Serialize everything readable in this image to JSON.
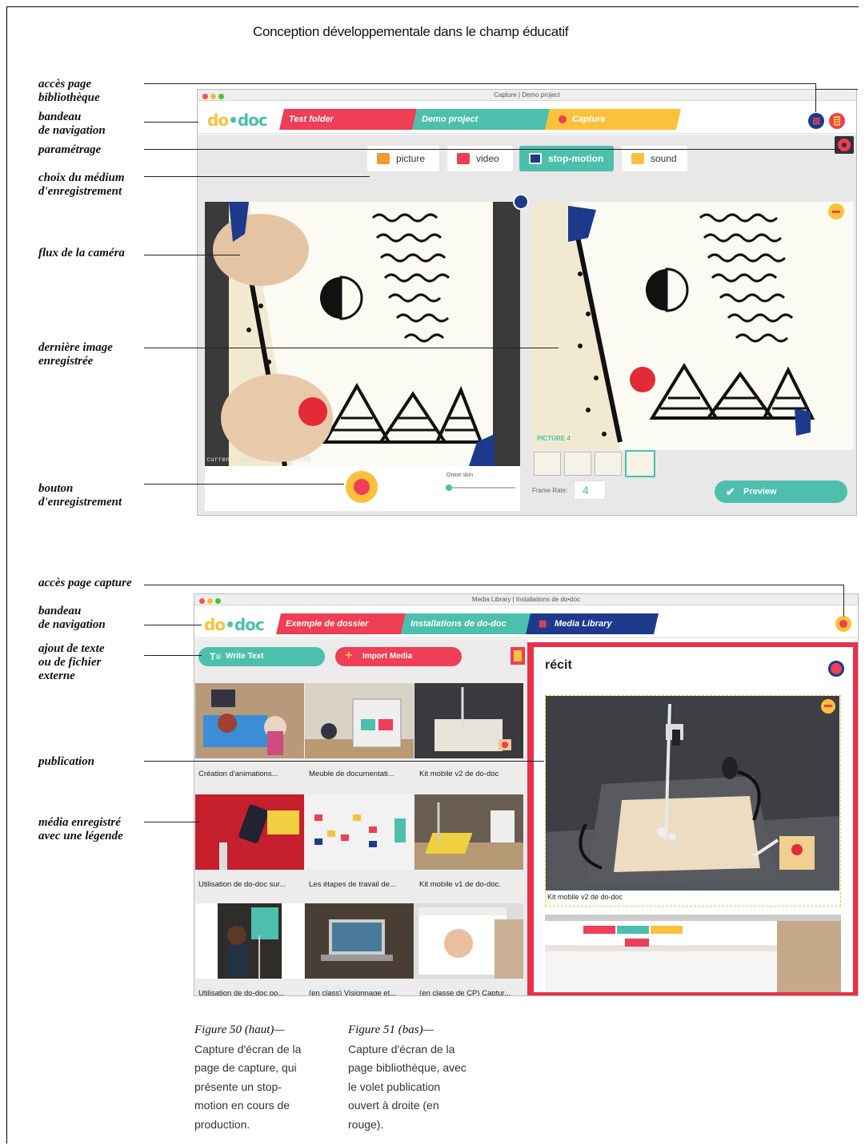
{
  "page_title": "Conception développementale dans le champ éducatif",
  "annotations_top": [
    [
      "accès page",
      "bibliothèque"
    ],
    [
      "bandeau",
      "de navigation"
    ],
    [
      "paramétrage"
    ],
    [
      "choix du médium",
      "d'enregistrement"
    ],
    [
      "flux de la caméra"
    ],
    [
      "dernière image",
      "enregistrée"
    ],
    [
      "bouton",
      "d'enregistrement"
    ]
  ],
  "annotations_bottom": [
    [
      "accès page capture"
    ],
    [
      "bandeau",
      "de navigation"
    ],
    [
      "ajout de texte",
      "ou de fichier",
      "externe"
    ],
    [
      "publication"
    ],
    [
      "média enregistré",
      "avec une légende"
    ]
  ],
  "capture_window": {
    "title": "Capture | Demo project",
    "logo": "do•doc",
    "tabs": [
      "Test folder",
      "Demo project",
      "Capture"
    ],
    "media_buttons": [
      "picture",
      "video",
      "stop-motion",
      "sound"
    ],
    "resolution": "current resolution: 720×720",
    "onion_skin": "Onion skin",
    "picture_label": "PICTURE 4",
    "frame_rate_label": "Frame Rate:",
    "frame_rate_value": "4",
    "preview_label": "Preview",
    "onion_level": 0.05
  },
  "library_window": {
    "title": "Media Library | Installations de do•doc",
    "logo": "do•doc",
    "tabs": [
      "Exemple de dossier",
      "Installations de do-doc",
      "Media Library"
    ],
    "write_text": "Write Text",
    "import_media": "Import Media",
    "captions": [
      "Création d'animations...",
      "Meuble de documentati...",
      "Kit mobile v2 de do-doc",
      "Utilisation de do-doc sur...",
      "Les étapes de travail de...",
      "Kit mobile v1 de do-doc.",
      "Utilisation de do-doc po...",
      "(en class) Visionnage et...",
      "(en classe de CP) Captur..."
    ],
    "panel_title": "récit",
    "panel_caption": "Kit mobile v2 de do-doc"
  },
  "figures": [
    {
      "heading": "Figure 50 (haut)—",
      "lines": [
        "Capture d'écran de la",
        "page de capture, qui",
        "présente un stop-",
        "motion en cours de",
        "production."
      ]
    },
    {
      "heading": "Figure 51 (bas)—",
      "lines": [
        "Capture d'écran de la",
        "page bibliothèque, avec",
        "le volet publication",
        "ouvert à droite (en",
        "rouge)."
      ]
    }
  ],
  "colors": {
    "red": "#ef3e55",
    "teal": "#4cc0ad",
    "yellow": "#fcc13b",
    "navy": "#1d3a8c",
    "panel_red": "#ea2f49"
  }
}
